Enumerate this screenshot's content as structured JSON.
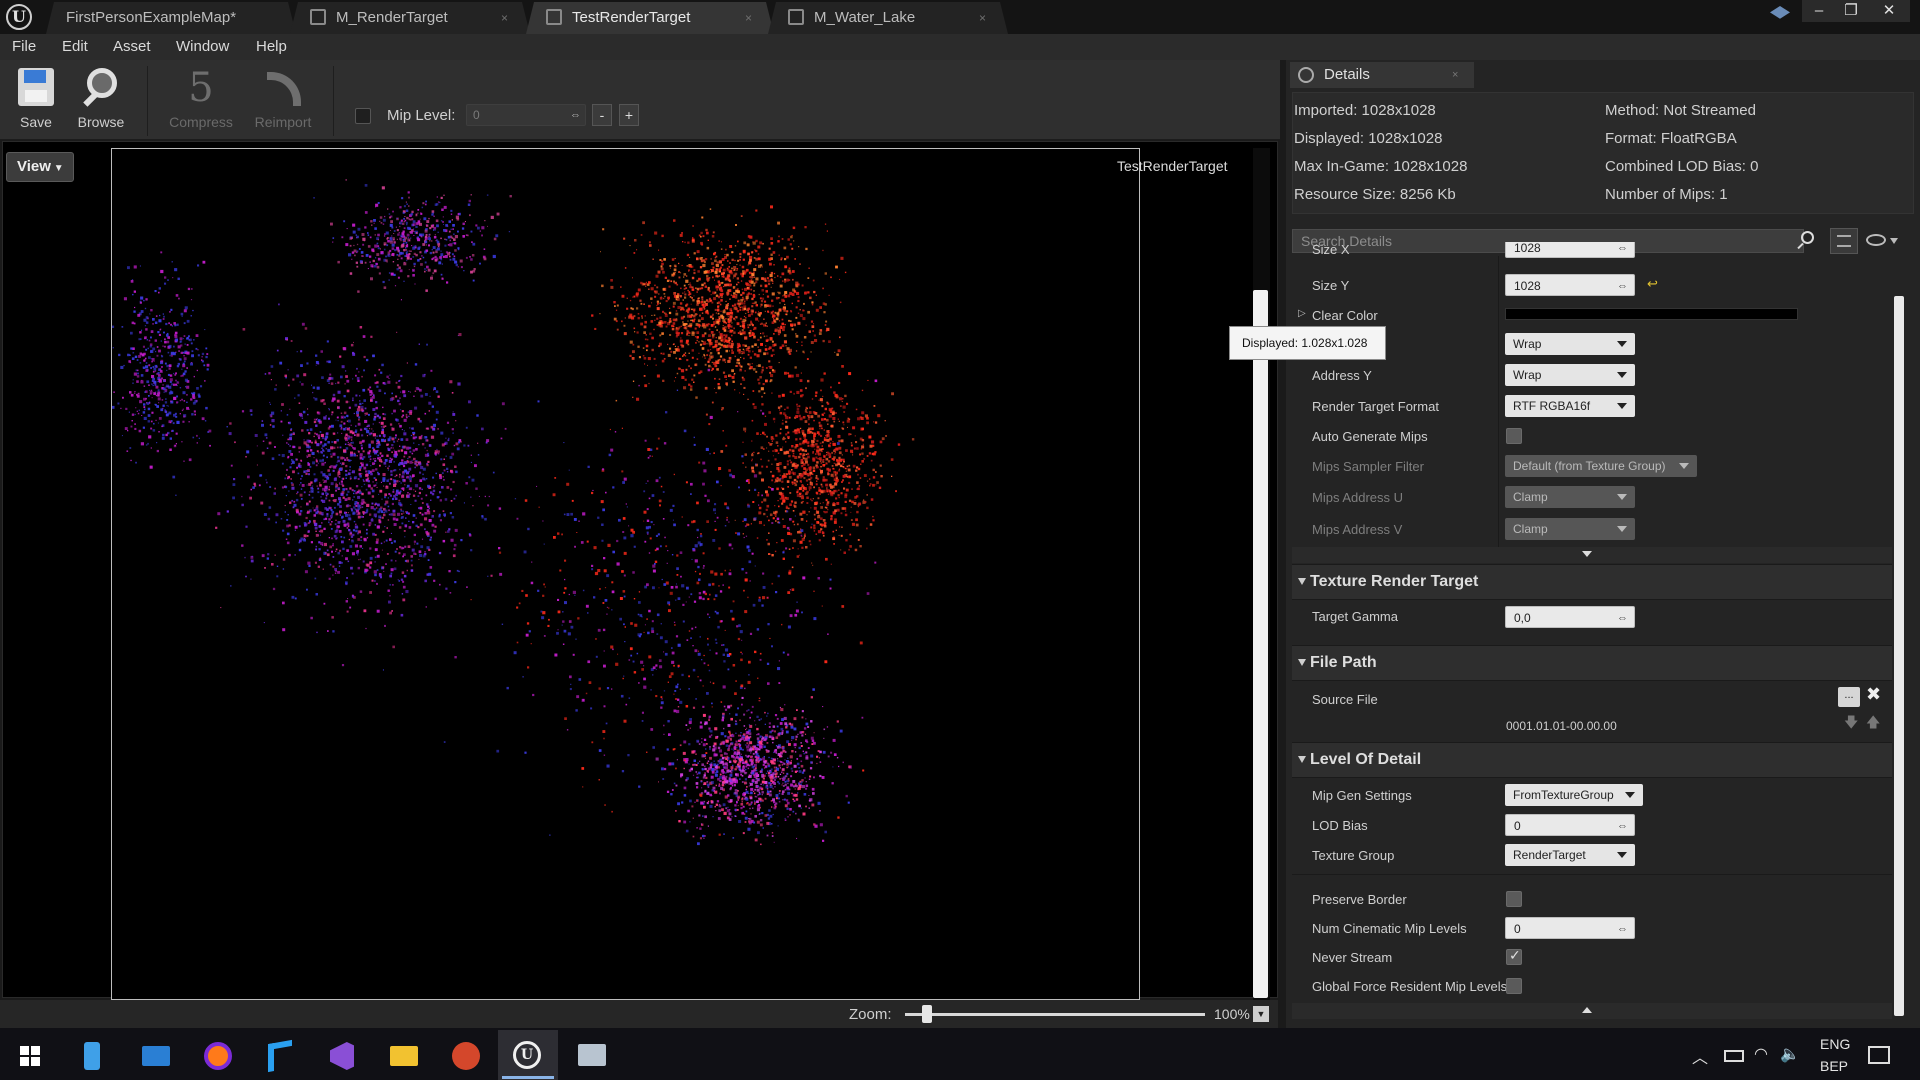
{
  "tabs": [
    {
      "label": "FirstPersonExampleMap*"
    },
    {
      "label": "M_RenderTarget"
    },
    {
      "label": "TestRenderTarget"
    },
    {
      "label": "M_Water_Lake"
    }
  ],
  "menu": [
    "File",
    "Edit",
    "Asset",
    "Window",
    "Help"
  ],
  "toolbar": {
    "save": "Save",
    "browse": "Browse",
    "compress": "Compress",
    "reimport": "Reimport",
    "mip_label": "Mip Level:",
    "mip_value": "0",
    "minus": "-",
    "plus": "+"
  },
  "viewport": {
    "view_button": "View",
    "title": "TestRenderTarget",
    "zoom_label": "Zoom:",
    "zoom_value": "100%"
  },
  "details": {
    "tab": "Details",
    "info_left": [
      "Imported: 1028x1028",
      "Displayed: 1028x1028",
      "Max In-Game: 1028x1028",
      "Resource Size: 8256 Kb"
    ],
    "info_right": [
      "Method: Not Streamed",
      "Format: FloatRGBA",
      "Combined LOD Bias: 0",
      "Number of Mips: 1"
    ],
    "search_placeholder": "Search Details",
    "tooltip": "Displayed: 1.028x1.028",
    "props": {
      "size_x": {
        "label": "Size X",
        "value": "1028"
      },
      "size_y": {
        "label": "Size Y",
        "value": "1028"
      },
      "clear_color": {
        "label": "Clear Color"
      },
      "address_x": {
        "value": "Wrap"
      },
      "address_y": {
        "label": "Address Y",
        "value": "Wrap"
      },
      "rt_format": {
        "label": "Render Target Format",
        "value": "RTF RGBA16f"
      },
      "auto_mips": {
        "label": "Auto Generate Mips"
      },
      "mips_filter": {
        "label": "Mips Sampler Filter",
        "value": "Default (from Texture Group)"
      },
      "mips_u": {
        "label": "Mips Address U",
        "value": "Clamp"
      },
      "mips_v": {
        "label": "Mips Address V",
        "value": "Clamp"
      }
    },
    "sections": {
      "trt": "Texture Render Target",
      "file_path": "File Path",
      "lod": "Level Of Detail"
    },
    "target_gamma": {
      "label": "Target Gamma",
      "value": "0,0"
    },
    "source_file": {
      "label": "Source File",
      "timestamp": "0001.01.01-00.00.00",
      "browse": "..."
    },
    "lod_props": {
      "mip_gen": {
        "label": "Mip Gen Settings",
        "value": "FromTextureGroup"
      },
      "lod_bias": {
        "label": "LOD Bias",
        "value": "0"
      },
      "tex_group": {
        "label": "Texture Group",
        "value": "RenderTarget"
      },
      "preserve_border": {
        "label": "Preserve Border"
      },
      "num_cine": {
        "label": "Num Cinematic Mip Levels",
        "value": "0"
      },
      "never_stream": {
        "label": "Never Stream"
      },
      "global_force": {
        "label": "Global Force Resident Mip Levels"
      }
    }
  },
  "taskbar": {
    "lang_top": "ENG",
    "lang_bottom": "BEP"
  },
  "colors": {
    "accent_red": "#ff2a1a",
    "accent_magenta": "#c01cc8",
    "accent_blue": "#3a3ae0",
    "panel_bg": "#242424"
  }
}
